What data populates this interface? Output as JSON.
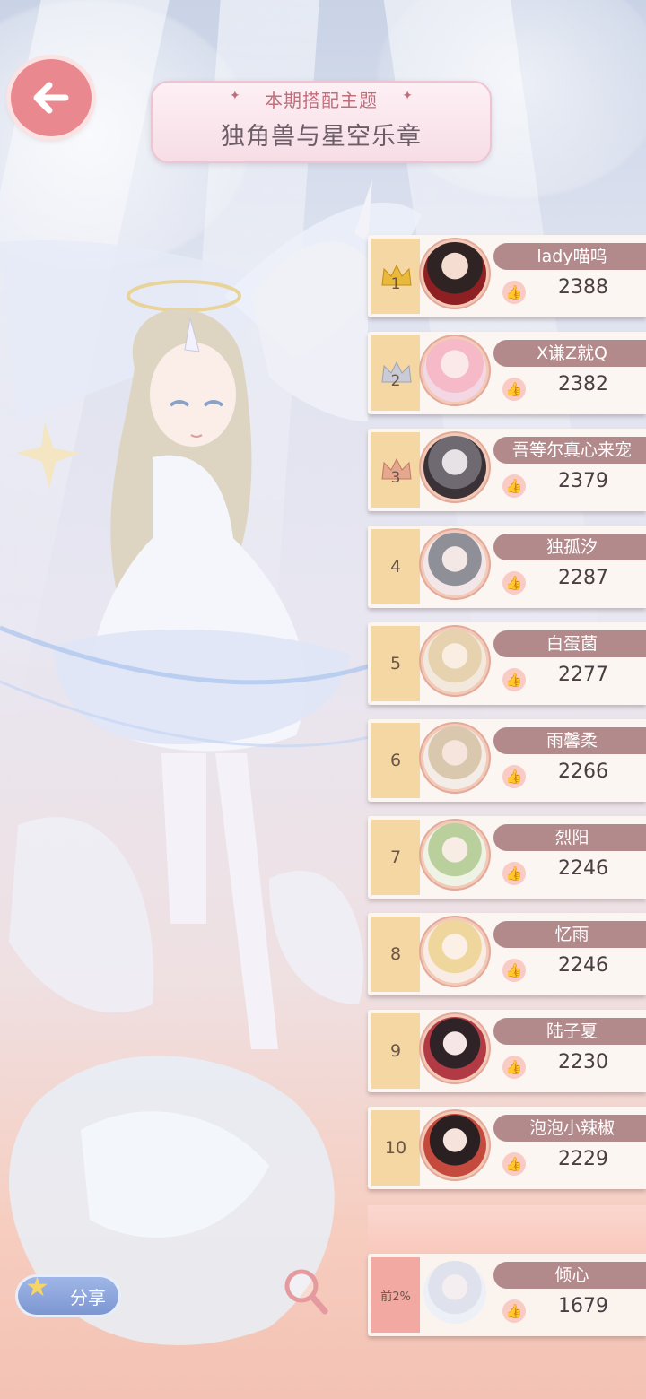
{
  "theme": {
    "subtitle": "本期搭配主题",
    "title": "独角兽与星空乐章"
  },
  "ranking": [
    {
      "rank": "1",
      "name": "lady喵呜",
      "score": "2388",
      "crown": "gold"
    },
    {
      "rank": "2",
      "name": "X谦Z就Q",
      "score": "2382",
      "crown": "silver"
    },
    {
      "rank": "3",
      "name": "吾等尔真心来宠",
      "score": "2379",
      "crown": "bronze"
    },
    {
      "rank": "4",
      "name": "独孤汐",
      "score": "2287"
    },
    {
      "rank": "5",
      "name": "白蛋菌",
      "score": "2277"
    },
    {
      "rank": "6",
      "name": "雨馨柔",
      "score": "2266"
    },
    {
      "rank": "7",
      "name": "烈阳",
      "score": "2246"
    },
    {
      "rank": "8",
      "name": "忆雨",
      "score": "2246"
    },
    {
      "rank": "9",
      "name": "陆子夏",
      "score": "2230"
    },
    {
      "rank": "10",
      "name": "泡泡小辣椒",
      "score": "2229"
    }
  ],
  "my_entry": {
    "rank": "前2%",
    "name": "倾心",
    "score": "1679"
  },
  "buttons": {
    "share_label": "分享",
    "back_icon": "arrow-left-icon",
    "zoom_icon": "magnifier-icon"
  },
  "colors": {
    "name_tag": "#b38a8c",
    "rank_cell": "#f5d7a3",
    "my_rank_cell": "#f1a9a2",
    "back_button": "#e9888f",
    "share_button": "#8aa4dc"
  }
}
